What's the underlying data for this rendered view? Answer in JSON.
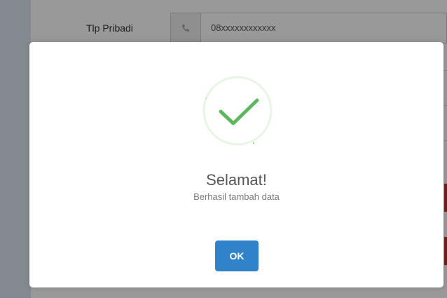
{
  "background_form": {
    "phone_label": "Tlp Pribadi",
    "phone_value": "08xxxxxxxxxxxx",
    "phone_icon": "phone-icon"
  },
  "dialog": {
    "icon": "success-check-icon",
    "title": "Selamat!",
    "message": "Berhasil tambah data",
    "ok_label": "OK"
  },
  "colors": {
    "accent_button": "#3083c9",
    "success_green": "#5cb85c",
    "danger_bar": "#c0392b"
  }
}
